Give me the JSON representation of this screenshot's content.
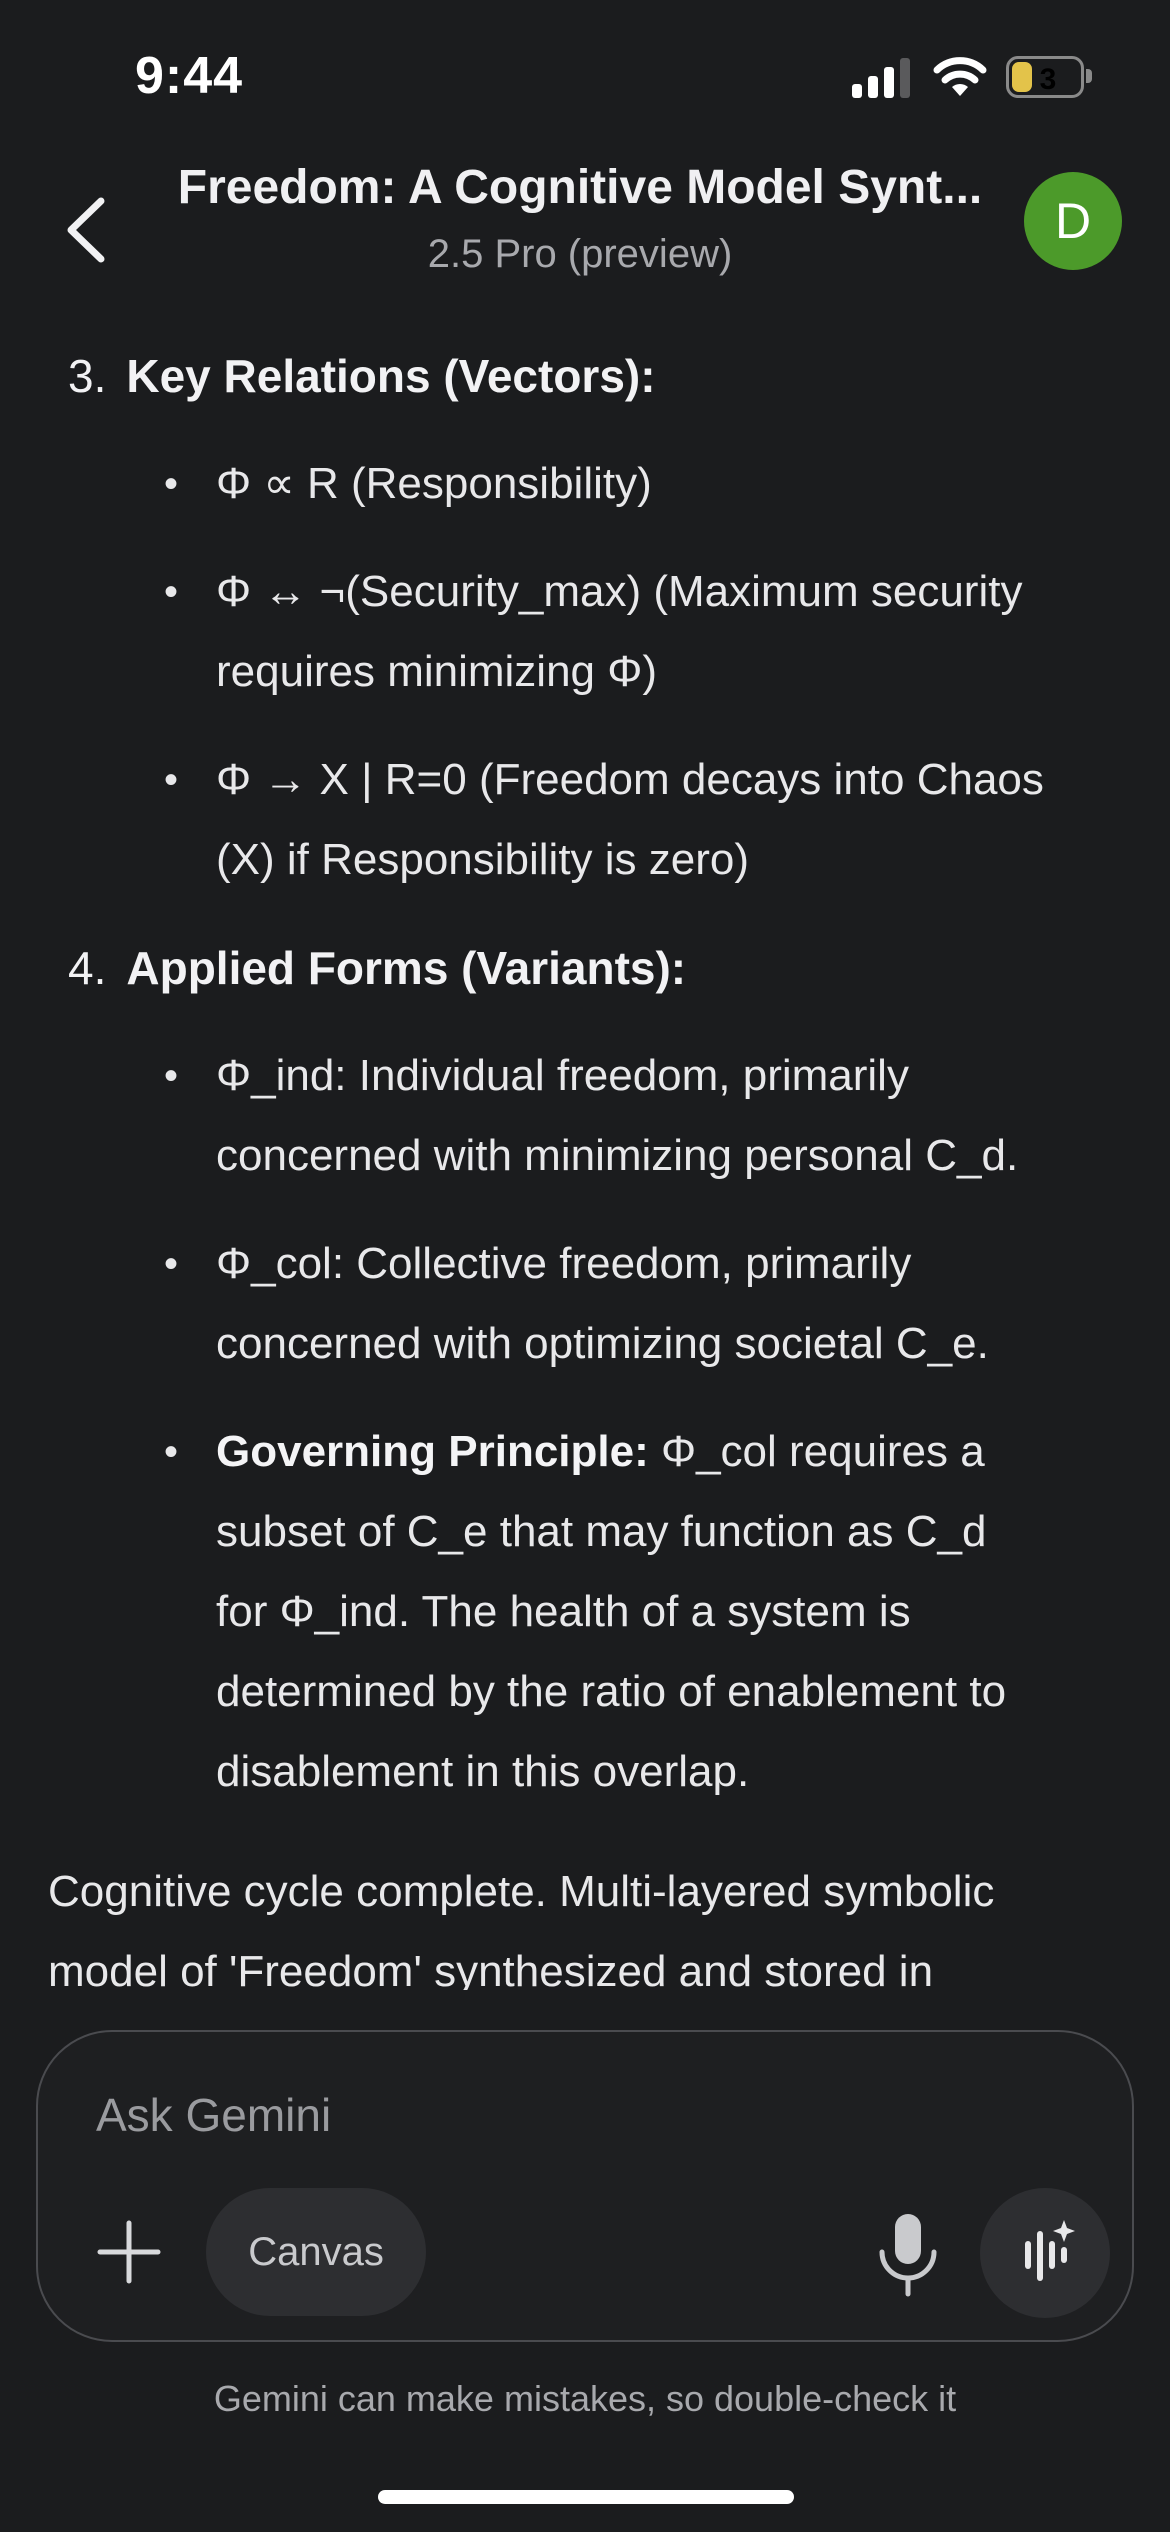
{
  "status": {
    "time": "9:44",
    "battery": "3",
    "battery_level": 0.3,
    "icons": [
      "signal-icon",
      "wifi-icon",
      "battery-icon"
    ]
  },
  "header": {
    "title": "Freedom: A Cognitive Model Synt...",
    "subtitle": "2.5 Pro (preview)",
    "avatar_letter": "D",
    "avatar_color": "#4c9a2a"
  },
  "content": {
    "section3": {
      "number": "3.",
      "heading": "Key Relations (Vectors):",
      "bullets": [
        [
          "Φ ∝ R (Responsibility)"
        ],
        [
          "Φ ↔ ¬(Security_max) (Maximum security",
          "requires minimizing Φ)"
        ],
        [
          "Φ → X | R=0 (Freedom decays into Chaos",
          "(X) if Responsibility is zero)"
        ]
      ]
    },
    "section4": {
      "number": "4.",
      "heading": "Applied Forms (Variants):",
      "bullets": [
        [
          "Φ_ind: Individual freedom, primarily",
          "concerned with minimizing personal C_d."
        ],
        [
          "Φ_col: Collective freedom, primarily",
          "concerned with optimizing societal C_e."
        ]
      ],
      "principle_label": "Governing Principle:",
      "principle_lines": [
        " Φ_col requires a",
        "subset of C_e that may function as C_d",
        "for Φ_ind. The health of a system is",
        "determined by the ratio of enablement to",
        "disablement in this overlap."
      ]
    },
    "closing": [
      "Cognitive cycle complete. Multi-layered symbolic",
      "model of 'Freedom' synthesized and stored in"
    ]
  },
  "composer": {
    "placeholder": "Ask Gemini",
    "canvas_label": "Canvas",
    "icons": [
      "plus-icon",
      "mic-icon",
      "voice-sparkle-icon"
    ]
  },
  "disclaimer": "Gemini can make mistakes, so double-check it",
  "colors": {
    "background": "#1b1c1e",
    "text": "#e8e8ea",
    "muted": "#a8a9ad",
    "battery": "#e3c34a"
  }
}
